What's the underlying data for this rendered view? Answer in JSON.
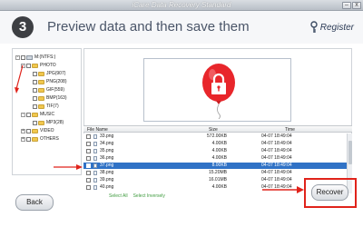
{
  "window": {
    "title": "iCare Data Recovery Standard",
    "minimize_glyph": "–",
    "close_glyph": "x"
  },
  "header": {
    "step_number": "3",
    "title": "Preview data and then save them",
    "register_label": "Register",
    "register_icon": "key-icon"
  },
  "tree": {
    "items": [
      {
        "label": "M:(NTFS:)",
        "type": "drive",
        "toggle": "-"
      },
      {
        "label": "PHOTO",
        "type": "folder",
        "toggle": "-"
      },
      {
        "label": "JPG(907)",
        "type": "folder",
        "toggle": ""
      },
      {
        "label": "PNG(208)",
        "type": "folder",
        "toggle": ""
      },
      {
        "label": "GIF(559)",
        "type": "folder",
        "toggle": ""
      },
      {
        "label": "BMP(163)",
        "type": "folder",
        "toggle": ""
      },
      {
        "label": "TIF(7)",
        "type": "folder",
        "toggle": ""
      },
      {
        "label": "MUSIC",
        "type": "folder",
        "toggle": "-"
      },
      {
        "label": "MP3(28)",
        "type": "folder",
        "toggle": ""
      },
      {
        "label": "VIDEO",
        "type": "folder",
        "toggle": "+"
      },
      {
        "label": "OTHERS",
        "type": "folder",
        "toggle": "+"
      }
    ]
  },
  "preview": {
    "icon": "lock-balloon-icon",
    "colors": {
      "balloon": "#e8262b",
      "lock": "#ffffff"
    }
  },
  "table": {
    "columns": [
      "File Name",
      "Size",
      "Time"
    ],
    "rows": [
      {
        "name": "33.png",
        "size": "572.00KB",
        "time": "04-07 18:49:04",
        "selected": false
      },
      {
        "name": "34.png",
        "size": "4.00KB",
        "time": "04-07 18:49:04",
        "selected": false
      },
      {
        "name": "35.png",
        "size": "4.00KB",
        "time": "04-07 18:49:04",
        "selected": false
      },
      {
        "name": "36.png",
        "size": "4.00KB",
        "time": "04-07 18:49:04",
        "selected": false
      },
      {
        "name": "37.png",
        "size": "8.00KB",
        "time": "04-07 18:49:04",
        "selected": true
      },
      {
        "name": "38.png",
        "size": "15.20MB",
        "time": "04-07 18:49:04",
        "selected": false
      },
      {
        "name": "39.png",
        "size": "16.01MB",
        "time": "04-07 18:49:04",
        "selected": false
      },
      {
        "name": "40.png",
        "size": "4.00KB",
        "time": "04-07 18:49:04",
        "selected": false
      }
    ],
    "select_all": "Select All",
    "select_inversely": "Select Inversely"
  },
  "footer": {
    "back_label": "Back",
    "recover_label": "Recover"
  },
  "colors": {
    "accent_selection": "#3072c6",
    "highlight_red": "#e0231b",
    "link_green": "#3f9b3f"
  }
}
